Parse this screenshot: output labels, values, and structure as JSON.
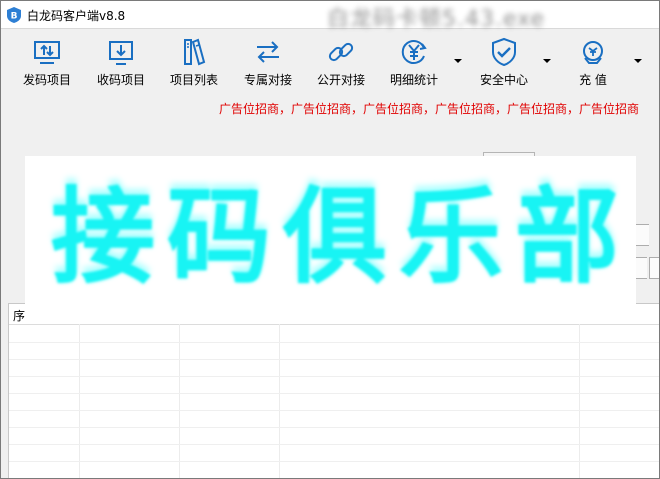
{
  "window": {
    "title": "白龙码客户端v8.8",
    "background_title": "白龙码卡顿5.43.exe"
  },
  "toolbar": {
    "items": [
      {
        "label": "发码项目",
        "icon": "upload-box-icon"
      },
      {
        "label": "收码项目",
        "icon": "download-box-icon"
      },
      {
        "label": "项目列表",
        "icon": "books-icon"
      },
      {
        "label": "专属对接",
        "icon": "swap-arrows-icon"
      },
      {
        "label": "公开对接",
        "icon": "link-icon"
      },
      {
        "label": "明细统计",
        "icon": "yuan-cycle-icon"
      },
      {
        "label": "安全中心",
        "icon": "shield-check-icon"
      },
      {
        "label": "充 值",
        "icon": "recharge-icon"
      }
    ],
    "accent_color": "#1a6fc2"
  },
  "ad_banner": {
    "text": "广告位招商，广告位招商，广告位招商，广告位招商，广告位招商，广告位招商",
    "color": "#e00000"
  },
  "overlay": {
    "text": "接码俱乐部",
    "color": "#18f4f4"
  },
  "table": {
    "columns": [
      "序"
    ]
  }
}
